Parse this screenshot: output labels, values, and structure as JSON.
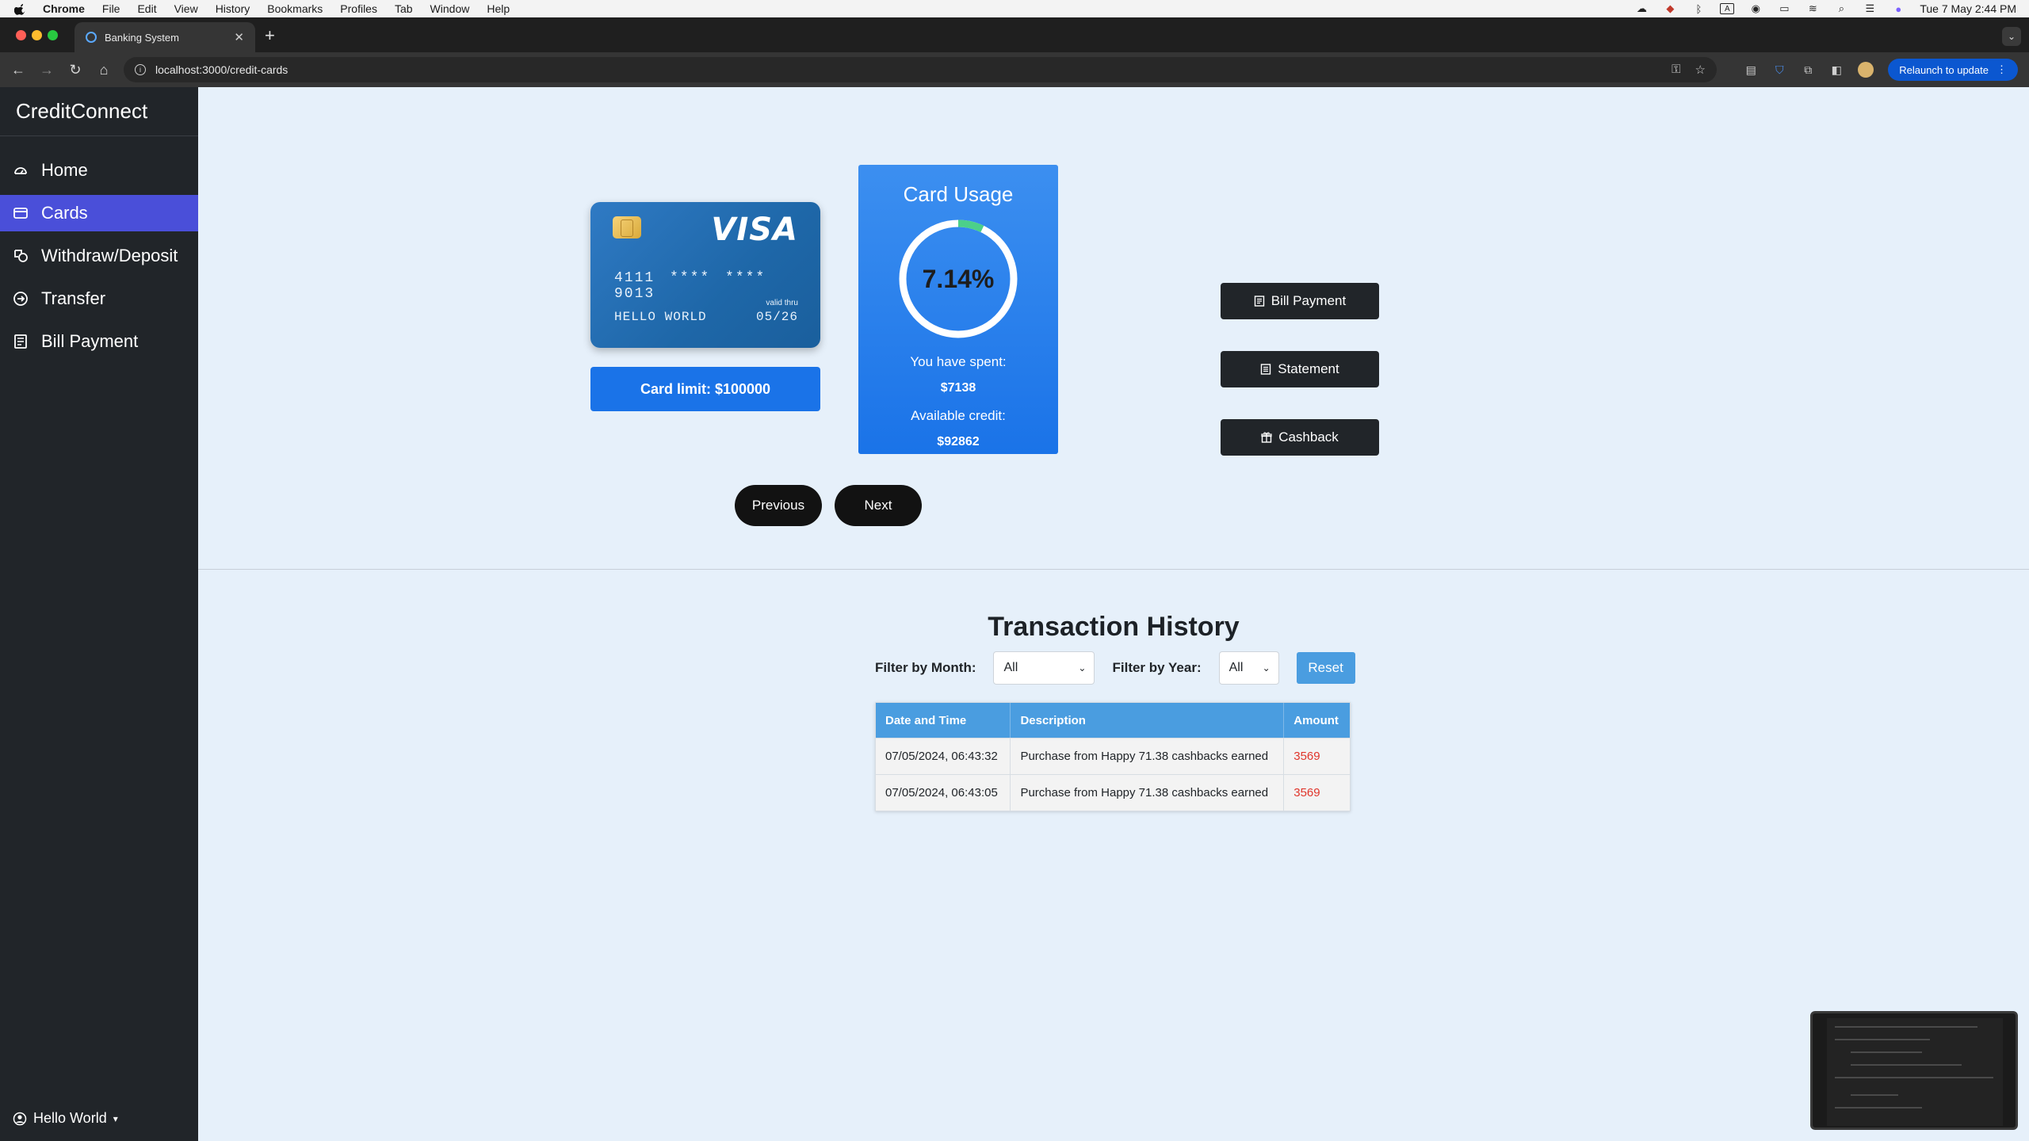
{
  "menubar": {
    "app": "Chrome",
    "items": [
      "File",
      "Edit",
      "View",
      "History",
      "Bookmarks",
      "Profiles",
      "Tab",
      "Window",
      "Help"
    ],
    "clock": "Tue 7 May  2:44 PM"
  },
  "browser": {
    "tab_title": "Banking System",
    "url": "localhost:3000/credit-cards",
    "relaunch_label": "Relaunch to update"
  },
  "sidebar": {
    "brand": "CreditConnect",
    "items": [
      {
        "label": "Home",
        "icon": "dashboard-icon"
      },
      {
        "label": "Cards",
        "icon": "credit-card-icon",
        "active": true
      },
      {
        "label": "Withdraw/Deposit",
        "icon": "cash-coin-icon"
      },
      {
        "label": "Transfer",
        "icon": "arrow-circle-icon"
      },
      {
        "label": "Bill Payment",
        "icon": "receipt-icon"
      }
    ],
    "user": "Hello World"
  },
  "card": {
    "brand": "VISA",
    "number": "4111 **** **** 9013",
    "holder": "HELLO WORLD",
    "valid_label": "valid thru",
    "expiry": "05/26",
    "limit_label": "Card limit: $100000"
  },
  "usage": {
    "title": "Card Usage",
    "percent_label": "7.14%",
    "percent_value": 7.14,
    "spent_label": "You have spent:",
    "spent_value": "$7138",
    "available_label": "Available credit:",
    "available_value": "$92862",
    "track_color": "#ffffff",
    "progress_color": "#4cd08a"
  },
  "pager": {
    "previous": "Previous",
    "next": "Next"
  },
  "actions": {
    "bill_payment": "Bill Payment",
    "statement": "Statement",
    "cashback": "Cashback"
  },
  "history": {
    "title": "Transaction History",
    "month_label": "Filter by Month:",
    "month_value": "All",
    "year_label": "Filter by Year:",
    "year_value": "All",
    "reset": "Reset",
    "columns": [
      "Date and Time",
      "Description",
      "Amount"
    ],
    "rows": [
      {
        "date": "07/05/2024, 06:43:32",
        "description": "Purchase from Happy 71.38 cashbacks earned",
        "amount": "3569"
      },
      {
        "date": "07/05/2024, 06:43:05",
        "description": "Purchase from Happy 71.38 cashbacks earned",
        "amount": "3569"
      }
    ]
  },
  "colors": {
    "sidebar_bg": "#212529",
    "active_nav": "#4a4fd9",
    "primary": "#1a73e8",
    "table_header": "#4a9de0",
    "amount_text": "#e0352b"
  }
}
